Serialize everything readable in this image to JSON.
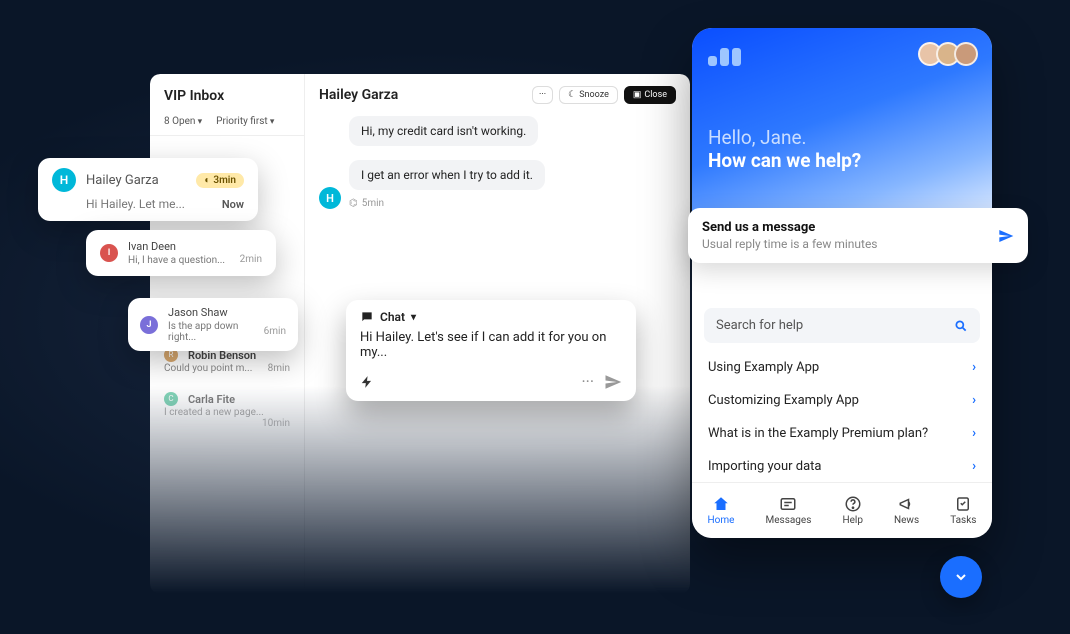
{
  "inbox": {
    "title": "VIP Inbox",
    "filter_open": "8 Open",
    "filter_sort": "Priority first",
    "faded": [
      {
        "initial": "R",
        "color": "#d9a96f",
        "name": "Robin Benson",
        "snippet": "Could you point m...",
        "time": "8min"
      },
      {
        "initial": "C",
        "color": "#4fc39b",
        "name": "Carla Fite",
        "snippet": "I created a new page...",
        "time": "10min"
      }
    ]
  },
  "conversation": {
    "contact": "Hailey Garza",
    "actions": {
      "more": "···",
      "snooze": "Snooze",
      "close": "Close"
    },
    "messages": [
      {
        "text": "Hi, my credit card isn't working."
      },
      {
        "text": "I get an error when I try to add it.",
        "meta": "5min"
      }
    ],
    "avatar_initial": "H"
  },
  "float1": {
    "initial": "H",
    "color": "#00b8d9",
    "name": "Hailey Garza",
    "pill": "3min",
    "sub": "Hi Hailey. Let me...",
    "time": "Now"
  },
  "float2": {
    "initial": "I",
    "color": "#d9534f",
    "name": "Ivan Deen",
    "sub": "Hi, I have a question...",
    "time": "2min"
  },
  "float3": {
    "initial": "J",
    "color": "#7a6fd9",
    "name": "Jason Shaw",
    "sub": "Is the app down right...",
    "time": "6min"
  },
  "composer": {
    "channel": "Chat",
    "text": "Hi Hailey. Let's see if I can add it for you on my..."
  },
  "messenger": {
    "greeting": "Hello, Jane.",
    "prompt": "How can we help?",
    "cta_title": "Send us a message",
    "cta_sub": "Usual reply time is a few minutes",
    "search_placeholder": "Search for help",
    "help_items": [
      "Using Examply App",
      "Customizing Examply App",
      "What is in the Examply Premium plan?",
      "Importing your data"
    ],
    "tabs": [
      "Home",
      "Messages",
      "Help",
      "News",
      "Tasks"
    ]
  }
}
